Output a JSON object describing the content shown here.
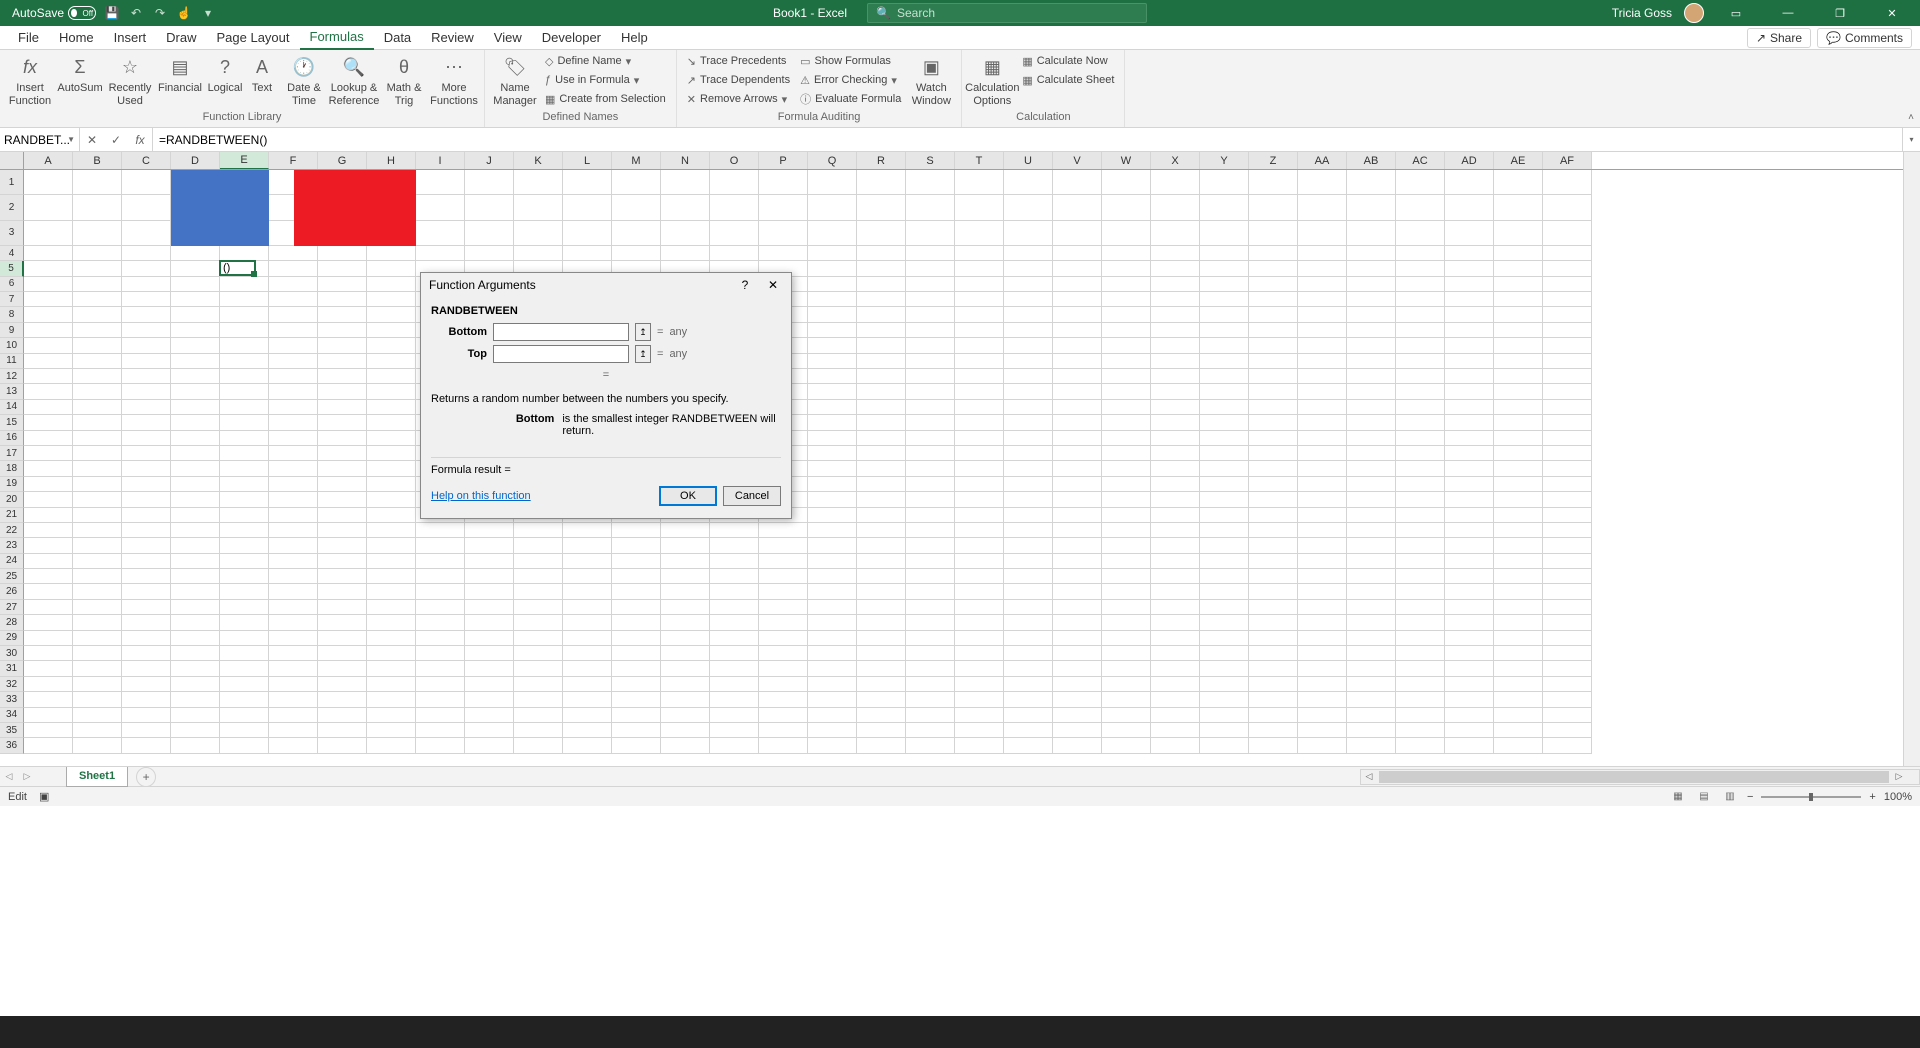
{
  "titlebar": {
    "autosave": "AutoSave",
    "autosave_state": "Off",
    "doc_title": "Book1  -  Excel",
    "search_placeholder": "Search",
    "user_name": "Tricia Goss"
  },
  "menus": [
    "File",
    "Home",
    "Insert",
    "Draw",
    "Page Layout",
    "Formulas",
    "Data",
    "Review",
    "View",
    "Developer",
    "Help"
  ],
  "menu_active_index": 5,
  "share_label": "Share",
  "comments_label": "Comments",
  "ribbon": {
    "groups": {
      "function_library": {
        "label": "Function Library",
        "insert_function": "Insert\nFunction",
        "autosum": "AutoSum",
        "recently_used": "Recently\nUsed",
        "financial": "Financial",
        "logical": "Logical",
        "text": "Text",
        "date_time": "Date &\nTime",
        "lookup_ref": "Lookup &\nReference",
        "math_trig": "Math &\nTrig",
        "more_functions": "More\nFunctions"
      },
      "defined_names": {
        "label": "Defined Names",
        "name_manager": "Name\nManager",
        "define_name": "Define Name",
        "use_in_formula": "Use in Formula",
        "create_from_selection": "Create from Selection"
      },
      "formula_auditing": {
        "label": "Formula Auditing",
        "trace_precedents": "Trace Precedents",
        "trace_dependents": "Trace Dependents",
        "remove_arrows": "Remove Arrows",
        "show_formulas": "Show Formulas",
        "error_checking": "Error Checking",
        "evaluate_formula": "Evaluate Formula",
        "watch_window": "Watch\nWindow"
      },
      "calculation": {
        "label": "Calculation",
        "calculation_options": "Calculation\nOptions",
        "calculate_now": "Calculate Now",
        "calculate_sheet": "Calculate Sheet"
      }
    }
  },
  "formulabar": {
    "namebox": "RANDBET...",
    "formula": "=RANDBETWEEN()"
  },
  "columns": [
    "A",
    "B",
    "C",
    "D",
    "E",
    "F",
    "G",
    "H",
    "I",
    "J",
    "K",
    "L",
    "M",
    "N",
    "O",
    "P",
    "Q",
    "R",
    "S",
    "T",
    "U",
    "V",
    "W",
    "X",
    "Y",
    "Z",
    "AA",
    "AB",
    "AC",
    "AD",
    "AE",
    "AF"
  ],
  "active_col_index": 4,
  "rows": [
    1,
    2,
    3,
    4,
    5,
    6,
    7,
    8,
    9,
    10,
    11,
    12,
    13,
    14,
    15,
    16,
    17,
    18,
    19,
    20,
    21,
    22,
    23,
    24,
    25,
    26,
    27,
    28,
    29,
    30,
    31,
    32,
    33,
    34,
    35,
    36
  ],
  "tall_rows": [
    1,
    2,
    3
  ],
  "active_row": 5,
  "active_cell_display": "()",
  "sheets": {
    "active": "Sheet1"
  },
  "statusbar": {
    "mode": "Edit",
    "zoom": "100%"
  },
  "dialog": {
    "title": "Function Arguments",
    "function_name": "RANDBETWEEN",
    "args": {
      "bottom": {
        "label": "Bottom",
        "value": "",
        "result": "any"
      },
      "top": {
        "label": "Top",
        "value": "",
        "result": "any"
      }
    },
    "eq": "=",
    "description": "Returns a random number between the numbers you specify.",
    "arg_name": "Bottom",
    "arg_desc": "is the smallest integer RANDBETWEEN will return.",
    "formula_result_label": "Formula result =",
    "help_link": "Help on this function",
    "ok": "OK",
    "cancel": "Cancel"
  }
}
